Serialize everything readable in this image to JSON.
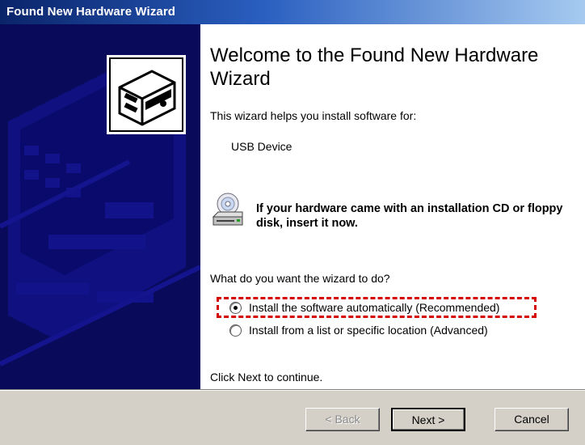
{
  "window": {
    "title": "Found New Hardware Wizard"
  },
  "main": {
    "welcome_title": "Welcome to the Found New Hardware Wizard",
    "intro": "This wizard helps you install software for:",
    "device_name": "USB Device",
    "cd_message": "If your hardware came with an installation CD or floppy disk, insert it now.",
    "question": "What do you want the wizard to do?",
    "options": [
      {
        "label": "Install the software automatically (Recommended)",
        "selected": true
      },
      {
        "label": "Install from a list or specific location (Advanced)",
        "selected": false
      }
    ],
    "continue_text": "Click Next to continue."
  },
  "buttons": {
    "back": "< Back",
    "next": "Next >",
    "cancel": "Cancel"
  },
  "icons": {
    "hardware": "hardware-box-icon",
    "cd": "cd-drive-icon"
  },
  "colors": {
    "titlebar_start": "#0a246a",
    "titlebar_end": "#a6caf0",
    "side_panel": "#0a0a5a",
    "highlight": "#d40000"
  }
}
